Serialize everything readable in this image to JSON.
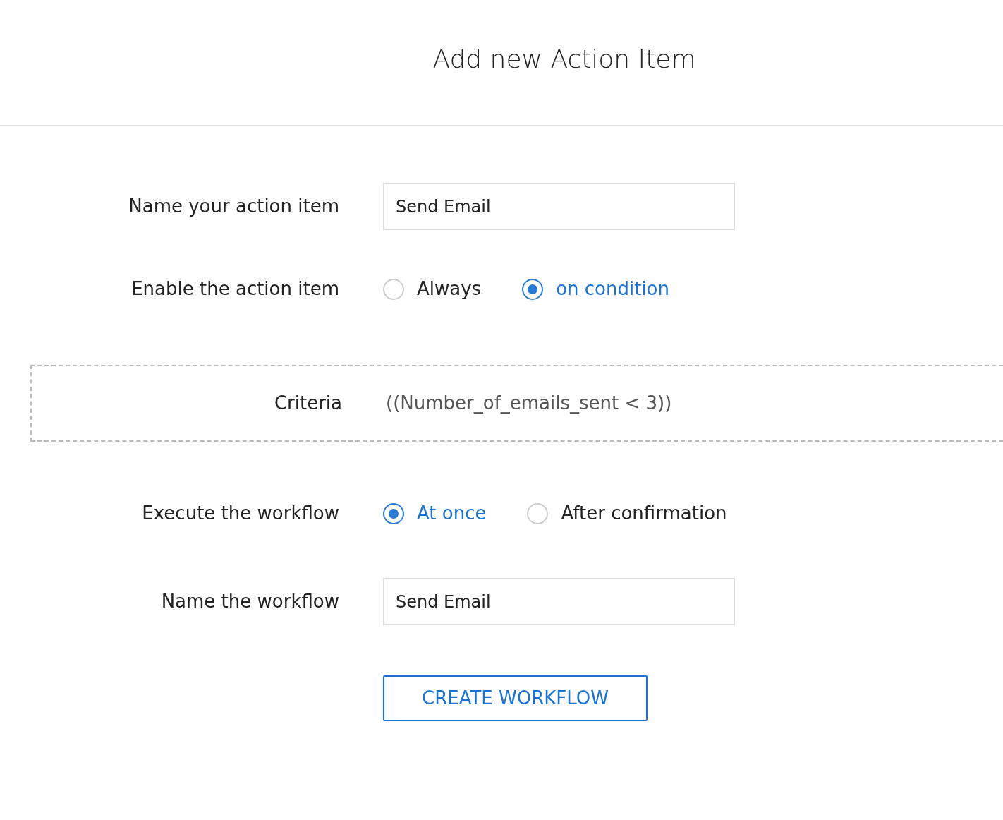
{
  "title": "Add new Action Item",
  "fields": [
    {
      "kind": "text",
      "label": "Name your action item",
      "value": "Send Email"
    },
    {
      "kind": "radio",
      "label": "Enable the action item",
      "options": [
        {
          "label": "Always",
          "selected": false
        },
        {
          "label": "on condition",
          "selected": true
        }
      ]
    },
    {
      "kind": "criteria",
      "label": "Criteria",
      "value": "((Number_of_emails_sent < 3))"
    },
    {
      "kind": "radio",
      "label": "Execute the workflow",
      "options": [
        {
          "label": "At once",
          "selected": true
        },
        {
          "label": "After confirmation",
          "selected": false
        }
      ]
    },
    {
      "kind": "text",
      "label": "Name the workflow",
      "value": "Send Email"
    }
  ],
  "button": "CREATE WORKFLOW"
}
